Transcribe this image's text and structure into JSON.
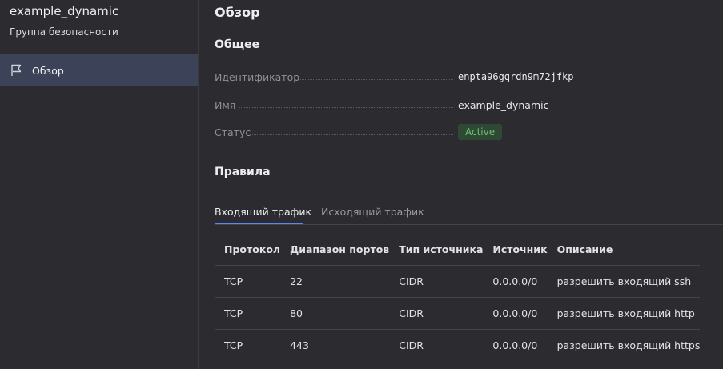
{
  "sidebar": {
    "resource_name": "example_dynamic",
    "resource_type": "Группа безопасности",
    "items": [
      {
        "label": "Обзор",
        "icon": "flag-icon"
      }
    ]
  },
  "main": {
    "title": "Обзор",
    "general": {
      "title": "Общее",
      "id_label": "Идентификатор",
      "id_value": "enpta96gqrdn9m72jfkp",
      "name_label": "Имя",
      "name_value": "example_dynamic",
      "status_label": "Статус",
      "status_value": "Active",
      "status_color": "#6ec06f"
    },
    "rules": {
      "title": "Правила",
      "tabs": [
        {
          "label": "Входящий трафик"
        },
        {
          "label": "Исходящий трафик"
        }
      ],
      "columns": [
        "Протокол",
        "Диапазон портов",
        "Тип источника",
        "Источник",
        "Описание"
      ],
      "rows": [
        [
          "TCP",
          "22",
          "CIDR",
          "0.0.0.0/0",
          "разрешить входящий ssh"
        ],
        [
          "TCP",
          "80",
          "CIDR",
          "0.0.0.0/0",
          "разрешить входящий http"
        ],
        [
          "TCP",
          "443",
          "CIDR",
          "0.0.0.0/0",
          "разрешить входящий https"
        ]
      ]
    }
  },
  "colors": {
    "accent": "#5f86f0",
    "sidebar_selected": "#3c4257",
    "background": "#2c2b30"
  }
}
